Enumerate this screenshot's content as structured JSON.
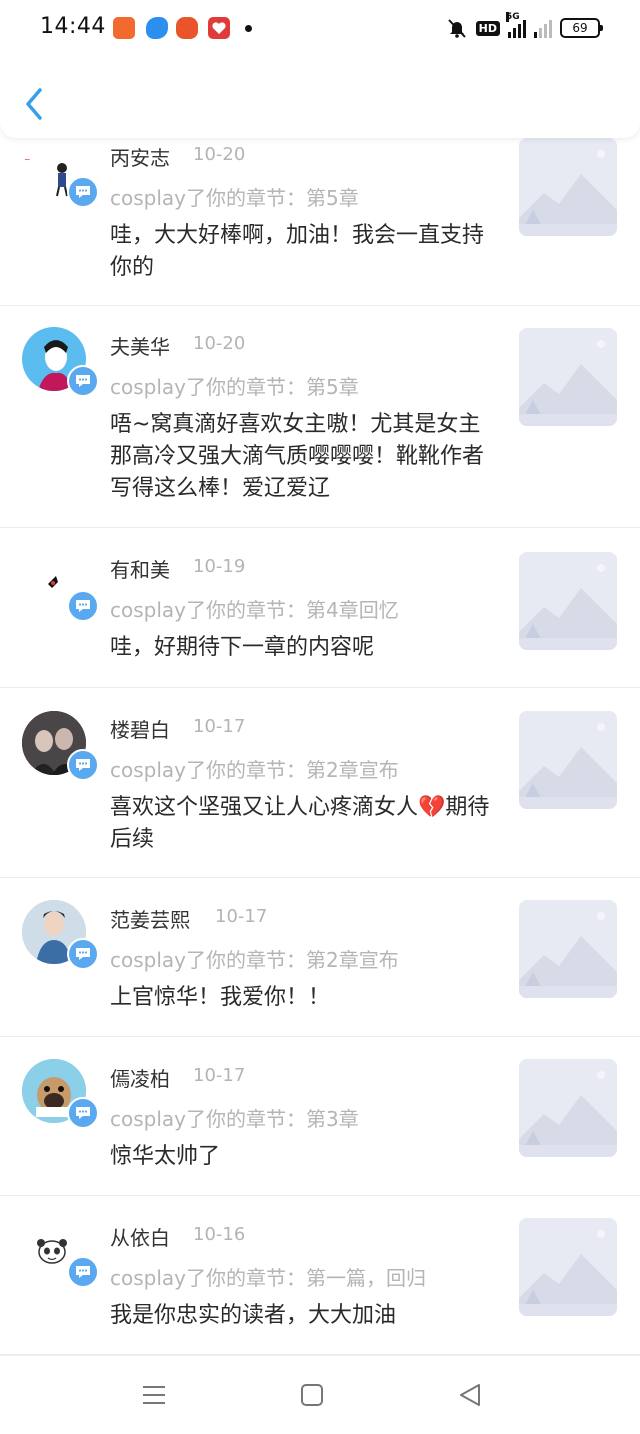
{
  "status_bar": {
    "time": "14:44",
    "network": "5G",
    "hd_label": "HD",
    "battery": "69",
    "icons": [
      "orange-app-icon",
      "blue-app-icon",
      "red-app-icon",
      "heart-app-icon",
      "mute-icon",
      "signal-icon",
      "signal-x-icon",
      "battery-icon"
    ]
  },
  "header": {
    "back_icon": "chevron-left-icon"
  },
  "comments": [
    {
      "name": "丙安志",
      "date": "10-20",
      "action": "cosplay了你的章节：第5章",
      "text": "哇，大大好棒啊，加油！我会一直支持你的"
    },
    {
      "name": "夫美华",
      "date": "10-20",
      "action": "cosplay了你的章节：第5章",
      "text": "唔~窝真滴好喜欢女主嗷！尤其是女主那高冷又强大滴气质嘤嘤嘤！靴靴作者写得这么棒！爱辽爱辽"
    },
    {
      "name": "有和美",
      "date": "10-19",
      "action": "cosplay了你的章节：第4章回忆",
      "text": "哇，好期待下一章的内容呢"
    },
    {
      "name": "楼碧白",
      "date": "10-17",
      "action": "cosplay了你的章节：第2章宣布",
      "text": "喜欢这个坚强又让人心疼滴女人💔期待后续"
    },
    {
      "name": "范姜芸熙",
      "date": "10-17",
      "action": "cosplay了你的章节：第2章宣布",
      "text": "上官惊华！我爱你！！"
    },
    {
      "name": "傿凌柏",
      "date": "10-17",
      "action": "cosplay了你的章节：第3章",
      "text": "惊华太帅了"
    },
    {
      "name": "从依白",
      "date": "10-16",
      "action": "cosplay了你的章节：第一篇，回归",
      "text": "我是你忠实的读者，大大加油"
    }
  ],
  "nav_bar": {
    "icons": [
      "menu-icon",
      "home-square-icon",
      "back-triangle-icon"
    ]
  },
  "colors": {
    "accent": "#5aa8ef",
    "name": "#333333",
    "muted": "#b5b5b5",
    "thumb_bg": "#e7e9f3"
  }
}
